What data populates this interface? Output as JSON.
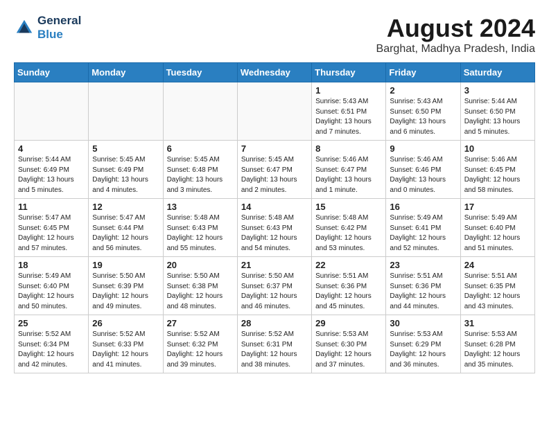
{
  "header": {
    "logo_line1": "General",
    "logo_line2": "Blue",
    "month_year": "August 2024",
    "location": "Barghat, Madhya Pradesh, India"
  },
  "weekdays": [
    "Sunday",
    "Monday",
    "Tuesday",
    "Wednesday",
    "Thursday",
    "Friday",
    "Saturday"
  ],
  "weeks": [
    [
      {
        "day": "",
        "sunrise": "",
        "sunset": "",
        "daylight": ""
      },
      {
        "day": "",
        "sunrise": "",
        "sunset": "",
        "daylight": ""
      },
      {
        "day": "",
        "sunrise": "",
        "sunset": "",
        "daylight": ""
      },
      {
        "day": "",
        "sunrise": "",
        "sunset": "",
        "daylight": ""
      },
      {
        "day": "1",
        "sunrise": "Sunrise: 5:43 AM",
        "sunset": "Sunset: 6:51 PM",
        "daylight": "Daylight: 13 hours and 7 minutes."
      },
      {
        "day": "2",
        "sunrise": "Sunrise: 5:43 AM",
        "sunset": "Sunset: 6:50 PM",
        "daylight": "Daylight: 13 hours and 6 minutes."
      },
      {
        "day": "3",
        "sunrise": "Sunrise: 5:44 AM",
        "sunset": "Sunset: 6:50 PM",
        "daylight": "Daylight: 13 hours and 5 minutes."
      }
    ],
    [
      {
        "day": "4",
        "sunrise": "Sunrise: 5:44 AM",
        "sunset": "Sunset: 6:49 PM",
        "daylight": "Daylight: 13 hours and 5 minutes."
      },
      {
        "day": "5",
        "sunrise": "Sunrise: 5:45 AM",
        "sunset": "Sunset: 6:49 PM",
        "daylight": "Daylight: 13 hours and 4 minutes."
      },
      {
        "day": "6",
        "sunrise": "Sunrise: 5:45 AM",
        "sunset": "Sunset: 6:48 PM",
        "daylight": "Daylight: 13 hours and 3 minutes."
      },
      {
        "day": "7",
        "sunrise": "Sunrise: 5:45 AM",
        "sunset": "Sunset: 6:47 PM",
        "daylight": "Daylight: 13 hours and 2 minutes."
      },
      {
        "day": "8",
        "sunrise": "Sunrise: 5:46 AM",
        "sunset": "Sunset: 6:47 PM",
        "daylight": "Daylight: 13 hours and 1 minute."
      },
      {
        "day": "9",
        "sunrise": "Sunrise: 5:46 AM",
        "sunset": "Sunset: 6:46 PM",
        "daylight": "Daylight: 13 hours and 0 minutes."
      },
      {
        "day": "10",
        "sunrise": "Sunrise: 5:46 AM",
        "sunset": "Sunset: 6:45 PM",
        "daylight": "Daylight: 12 hours and 58 minutes."
      }
    ],
    [
      {
        "day": "11",
        "sunrise": "Sunrise: 5:47 AM",
        "sunset": "Sunset: 6:45 PM",
        "daylight": "Daylight: 12 hours and 57 minutes."
      },
      {
        "day": "12",
        "sunrise": "Sunrise: 5:47 AM",
        "sunset": "Sunset: 6:44 PM",
        "daylight": "Daylight: 12 hours and 56 minutes."
      },
      {
        "day": "13",
        "sunrise": "Sunrise: 5:48 AM",
        "sunset": "Sunset: 6:43 PM",
        "daylight": "Daylight: 12 hours and 55 minutes."
      },
      {
        "day": "14",
        "sunrise": "Sunrise: 5:48 AM",
        "sunset": "Sunset: 6:43 PM",
        "daylight": "Daylight: 12 hours and 54 minutes."
      },
      {
        "day": "15",
        "sunrise": "Sunrise: 5:48 AM",
        "sunset": "Sunset: 6:42 PM",
        "daylight": "Daylight: 12 hours and 53 minutes."
      },
      {
        "day": "16",
        "sunrise": "Sunrise: 5:49 AM",
        "sunset": "Sunset: 6:41 PM",
        "daylight": "Daylight: 12 hours and 52 minutes."
      },
      {
        "day": "17",
        "sunrise": "Sunrise: 5:49 AM",
        "sunset": "Sunset: 6:40 PM",
        "daylight": "Daylight: 12 hours and 51 minutes."
      }
    ],
    [
      {
        "day": "18",
        "sunrise": "Sunrise: 5:49 AM",
        "sunset": "Sunset: 6:40 PM",
        "daylight": "Daylight: 12 hours and 50 minutes."
      },
      {
        "day": "19",
        "sunrise": "Sunrise: 5:50 AM",
        "sunset": "Sunset: 6:39 PM",
        "daylight": "Daylight: 12 hours and 49 minutes."
      },
      {
        "day": "20",
        "sunrise": "Sunrise: 5:50 AM",
        "sunset": "Sunset: 6:38 PM",
        "daylight": "Daylight: 12 hours and 48 minutes."
      },
      {
        "day": "21",
        "sunrise": "Sunrise: 5:50 AM",
        "sunset": "Sunset: 6:37 PM",
        "daylight": "Daylight: 12 hours and 46 minutes."
      },
      {
        "day": "22",
        "sunrise": "Sunrise: 5:51 AM",
        "sunset": "Sunset: 6:36 PM",
        "daylight": "Daylight: 12 hours and 45 minutes."
      },
      {
        "day": "23",
        "sunrise": "Sunrise: 5:51 AM",
        "sunset": "Sunset: 6:36 PM",
        "daylight": "Daylight: 12 hours and 44 minutes."
      },
      {
        "day": "24",
        "sunrise": "Sunrise: 5:51 AM",
        "sunset": "Sunset: 6:35 PM",
        "daylight": "Daylight: 12 hours and 43 minutes."
      }
    ],
    [
      {
        "day": "25",
        "sunrise": "Sunrise: 5:52 AM",
        "sunset": "Sunset: 6:34 PM",
        "daylight": "Daylight: 12 hours and 42 minutes."
      },
      {
        "day": "26",
        "sunrise": "Sunrise: 5:52 AM",
        "sunset": "Sunset: 6:33 PM",
        "daylight": "Daylight: 12 hours and 41 minutes."
      },
      {
        "day": "27",
        "sunrise": "Sunrise: 5:52 AM",
        "sunset": "Sunset: 6:32 PM",
        "daylight": "Daylight: 12 hours and 39 minutes."
      },
      {
        "day": "28",
        "sunrise": "Sunrise: 5:52 AM",
        "sunset": "Sunset: 6:31 PM",
        "daylight": "Daylight: 12 hours and 38 minutes."
      },
      {
        "day": "29",
        "sunrise": "Sunrise: 5:53 AM",
        "sunset": "Sunset: 6:30 PM",
        "daylight": "Daylight: 12 hours and 37 minutes."
      },
      {
        "day": "30",
        "sunrise": "Sunrise: 5:53 AM",
        "sunset": "Sunset: 6:29 PM",
        "daylight": "Daylight: 12 hours and 36 minutes."
      },
      {
        "day": "31",
        "sunrise": "Sunrise: 5:53 AM",
        "sunset": "Sunset: 6:28 PM",
        "daylight": "Daylight: 12 hours and 35 minutes."
      }
    ]
  ]
}
